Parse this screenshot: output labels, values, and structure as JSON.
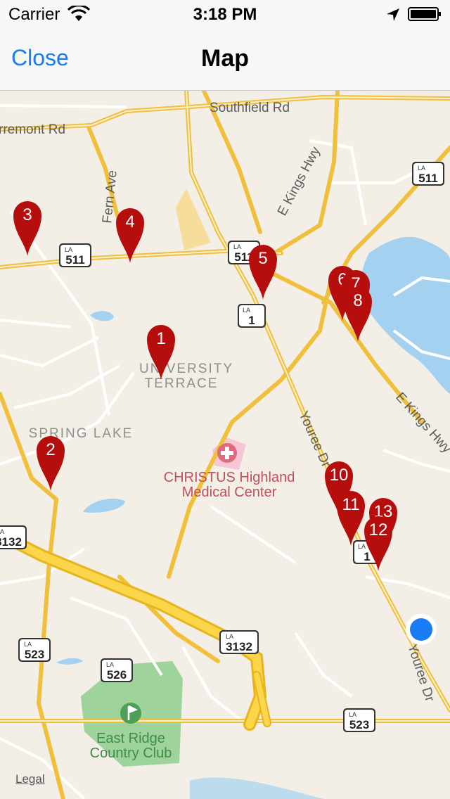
{
  "status_bar": {
    "carrier": "Carrier",
    "time": "3:18 PM"
  },
  "nav": {
    "close_label": "Close",
    "title": "Map"
  },
  "map": {
    "road_labels": [
      "Southfield Rd",
      "rremont Rd",
      "Fern Ave",
      "E Kings Hwy",
      "E Kings Hwy",
      "Youree Dr",
      "Youree Dr"
    ],
    "area_labels": [
      "UNIVERSITY",
      "TERRACE",
      "SPRING LAKE"
    ],
    "poi_labels": [
      "CHRISTUS Highland",
      "Medical Center",
      "East Ridge",
      "Country Club"
    ],
    "shields": [
      "511",
      "511",
      "511",
      "1",
      "1",
      "3132",
      "3132",
      "523",
      "526",
      "523"
    ],
    "shield_prefix": "LA",
    "pins": [
      "1",
      "2",
      "3",
      "4",
      "5",
      "6",
      "7",
      "8",
      "10",
      "11",
      "13",
      "12"
    ],
    "legal": "Legal"
  }
}
